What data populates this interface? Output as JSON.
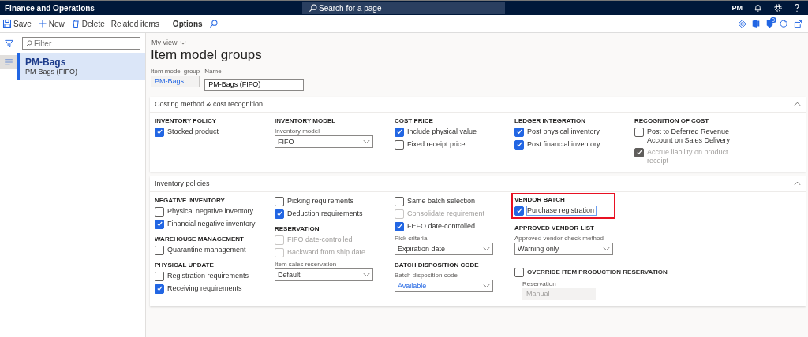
{
  "app": {
    "title": "Finance and Operations",
    "search_placeholder": "Search for a page",
    "user_initials": "PM",
    "notification_count": "0"
  },
  "toolbar": {
    "actions": [
      {
        "kind": "save",
        "label": "Save"
      },
      {
        "kind": "new",
        "label": "New"
      },
      {
        "kind": "delete",
        "label": "Delete"
      },
      {
        "kind": "plain",
        "label": "Related items"
      }
    ],
    "options_label": "Options"
  },
  "list": {
    "filter_placeholder": "Filter",
    "items": [
      {
        "title": "PM-Bags",
        "subtitle": "PM-Bags (FIFO)",
        "selected": true
      }
    ]
  },
  "view_label": "My view",
  "page_title": "Item model groups",
  "header_fields": [
    {
      "kind": "readonly",
      "label": "Item model group",
      "value": "PM-Bags"
    },
    {
      "kind": "input",
      "label": "Name",
      "value": "PM-Bags (FIFO)"
    }
  ],
  "sections": [
    {
      "title": "Costing method & cost recognition",
      "expanded": true,
      "columns": [
        [
          {
            "heading": "INVENTORY POLICY",
            "items": [
              {
                "kind": "checkbox",
                "label": "Stocked product",
                "checked": true,
                "disabled": false
              }
            ]
          }
        ],
        [
          {
            "heading": "INVENTORY MODEL",
            "items": [
              {
                "kind": "select",
                "label": "Inventory model",
                "value": "FIFO",
                "linked": false
              }
            ]
          }
        ],
        [
          {
            "heading": "COST PRICE",
            "items": [
              {
                "kind": "checkbox",
                "label": "Include physical value",
                "checked": true,
                "disabled": false
              },
              {
                "kind": "checkbox",
                "label": "Fixed receipt price",
                "checked": false,
                "disabled": false
              }
            ]
          }
        ],
        [
          {
            "heading": "LEDGER INTEGRATION",
            "items": [
              {
                "kind": "checkbox",
                "label": "Post physical inventory",
                "checked": true,
                "disabled": false
              },
              {
                "kind": "checkbox",
                "label": "Post financial inventory",
                "checked": true,
                "disabled": false
              }
            ]
          }
        ],
        [
          {
            "heading": "RECOGNITION OF COST",
            "items": [
              {
                "kind": "checkbox",
                "label": "Post to Deferred Revenue Account on Sales Delivery",
                "checked": false,
                "disabled": false
              },
              {
                "kind": "checkbox",
                "label": "Accrue liability on product receipt",
                "checked": true,
                "disabled": true
              }
            ]
          }
        ]
      ]
    },
    {
      "title": "Inventory policies",
      "expanded": true,
      "columns": [
        [
          {
            "heading": "NEGATIVE INVENTORY",
            "items": [
              {
                "kind": "checkbox",
                "label": "Physical negative inventory",
                "checked": false,
                "disabled": false
              },
              {
                "kind": "checkbox",
                "label": "Financial negative inventory",
                "checked": true,
                "disabled": false
              }
            ]
          },
          {
            "heading": "WAREHOUSE MANAGEMENT",
            "items": [
              {
                "kind": "checkbox",
                "label": "Quarantine management",
                "checked": false,
                "disabled": false
              }
            ]
          },
          {
            "heading": "PHYSICAL UPDATE",
            "items": [
              {
                "kind": "checkbox",
                "label": "Registration requirements",
                "checked": false,
                "disabled": false
              },
              {
                "kind": "checkbox",
                "label": "Receiving requirements",
                "checked": true,
                "disabled": false
              }
            ]
          }
        ],
        [
          {
            "items": [
              {
                "kind": "checkbox",
                "label": "Picking requirements",
                "checked": false,
                "disabled": false
              },
              {
                "kind": "checkbox",
                "label": "Deduction requirements",
                "checked": true,
                "disabled": false
              }
            ]
          },
          {
            "heading": "RESERVATION",
            "items": [
              {
                "kind": "checkbox",
                "label": "FIFO date-controlled",
                "checked": false,
                "disabled": true
              },
              {
                "kind": "checkbox",
                "label": "Backward from ship date",
                "checked": false,
                "disabled": true
              },
              {
                "kind": "select",
                "label": "Item sales reservation",
                "value": "Default",
                "linked": false
              }
            ]
          }
        ],
        [
          {
            "items": [
              {
                "kind": "checkbox",
                "label": "Same batch selection",
                "checked": false,
                "disabled": false
              },
              {
                "kind": "checkbox",
                "label": "Consolidate requirement",
                "checked": false,
                "disabled": true
              },
              {
                "kind": "checkbox",
                "label": "FEFO date-controlled",
                "checked": true,
                "disabled": false
              },
              {
                "kind": "select",
                "label": "Pick criteria",
                "value": "Expiration date",
                "linked": false
              }
            ]
          },
          {
            "heading": "BATCH DISPOSITION CODE",
            "items": [
              {
                "kind": "select",
                "label": "Batch disposition code",
                "value": "Available",
                "linked": true
              }
            ]
          }
        ],
        [
          {
            "heading": "VENDOR BATCH",
            "highlighted": true,
            "items": [
              {
                "kind": "checkbox",
                "label": "Purchase registration",
                "checked": true,
                "disabled": false,
                "focused": true
              }
            ]
          },
          {
            "heading": "APPROVED VENDOR LIST",
            "items": [
              {
                "kind": "select",
                "label": "Approved vendor check method",
                "value": "Warning only",
                "linked": false
              }
            ]
          },
          {
            "items": [
              {
                "kind": "heading_checkbox",
                "label": "OVERRIDE ITEM PRODUCTION RESERVATION",
                "checked": false,
                "disabled": false
              },
              {
                "kind": "field",
                "label": "Reservation",
                "value": "Manual",
                "disabled": true
              }
            ]
          }
        ]
      ]
    }
  ]
}
